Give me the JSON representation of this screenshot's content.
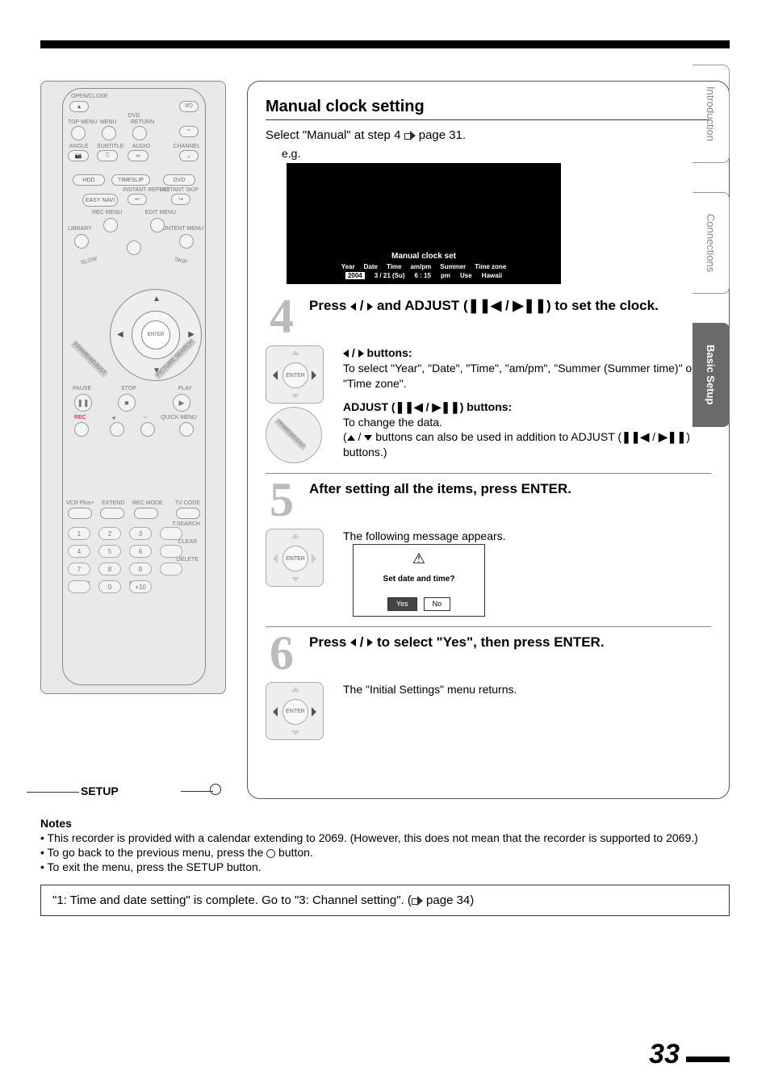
{
  "tabs": {
    "intro": "Introduction",
    "conn": "Connections",
    "basic": "Basic Setup"
  },
  "remote": {
    "labels": {
      "openclose": "OPEN/CLOSE",
      "dvd": "DVD",
      "topmenu": "TOP MENU",
      "menu": "MENU",
      "return": "RETURN",
      "angle": "ANGLE",
      "subtitle": "SUBTITLE",
      "audio": "AUDIO",
      "channel": "CHANNEL",
      "hdd": "HDD",
      "timeslip": "TIMESLIP",
      "dvd2": "DVD",
      "easynavi": "EASY NAVI",
      "instantreplay": "INSTANT REPLAY",
      "instantskip": "INSTANT SKIP",
      "recmenu": "REC MENU",
      "editmenu": "EDIT MENU",
      "library": "LIBRARY",
      "contentmenu": "CONTENT MENU",
      "slow": "SLOW",
      "skip": "SKIP",
      "frameadjust": "FRAME/ADJUST",
      "picturesearch": "PICTURE SEARCH",
      "pause": "PAUSE",
      "stop": "STOP",
      "play": "PLAY",
      "rec": "REC",
      "quickmenu": "QUICK MENU",
      "enter": "ENTER",
      "vcrplus": "VCR Plus+",
      "extend": "EXTEND",
      "recmode": "REC MODE",
      "tvcode": "TV CODE",
      "tsearch": "T.SEARCH",
      "clear": "CLEAR",
      "delete": "DELETE",
      "setup": "SETUP",
      "enter2": "ENTER",
      "plus10": "+10",
      "power": "I/⏻"
    },
    "keys": {
      "k1": "1",
      "k2": "2",
      "k3": "3",
      "k4": "4",
      "k5": "5",
      "k6": "6",
      "k7": "7",
      "k8": "8",
      "k9": "9",
      "k0": "0"
    }
  },
  "callout": {
    "setup": "SETUP"
  },
  "panel": {
    "title": "Manual clock setting",
    "intro_a": "Select \"Manual\" at step 4 ",
    "intro_b": " page 31.",
    "eg": "e.g.",
    "screen": {
      "title": "Manual clock set",
      "cols": {
        "year": "Year",
        "date": "Date",
        "time": "Time",
        "ampm": "am/pm",
        "summer": "Summer",
        "tz": "Time zone"
      },
      "vals": {
        "year": "2004",
        "date": "3 / 21 (Su)",
        "time": "6 : 15",
        "ampm": "pm",
        "summer": "Use",
        "tz": "Hawaii"
      }
    },
    "step4": {
      "num": "4",
      "head_a": "Press ",
      "head_b": " and ADJUST (",
      "head_c": ") to set the clock.",
      "btns_head": " buttons:",
      "btns_body": "To select \"Year\", \"Date\", \"Time\", \"am/pm\", \"Summer (Summer time)\" or \"Time zone\".",
      "adj_head_a": "ADJUST (",
      "adj_head_b": ") buttons:",
      "adj_body": "To change the data.",
      "adj_note_a": "(",
      "adj_note_b": " buttons can also be used in addition to ADJUST (",
      "adj_note_c": ") buttons.)"
    },
    "step5": {
      "num": "5",
      "head": "After setting all the items, press ENTER.",
      "body": "The following message appears.",
      "dlg": {
        "msg": "Set date and time?",
        "yes": "Yes",
        "no": "No"
      }
    },
    "step6": {
      "num": "6",
      "head_a": "Press ",
      "head_b": " to select \"Yes\", then press ENTER.",
      "body": "The \"Initial Settings\" menu returns."
    }
  },
  "notes": {
    "hdr": "Notes",
    "n1": "This recorder is provided with a calendar extending to 2069. (However, this does not mean that the recorder is supported to 2069.)",
    "n2a": "To go back to the previous menu, press the ",
    "n2b": " button.",
    "n3": "To exit the menu, press the SETUP button."
  },
  "footer": {
    "a": "\"1: Time and date setting\" is complete. Go to \"3: Channel setting\". (",
    "b": " page 34)"
  },
  "page": "33"
}
